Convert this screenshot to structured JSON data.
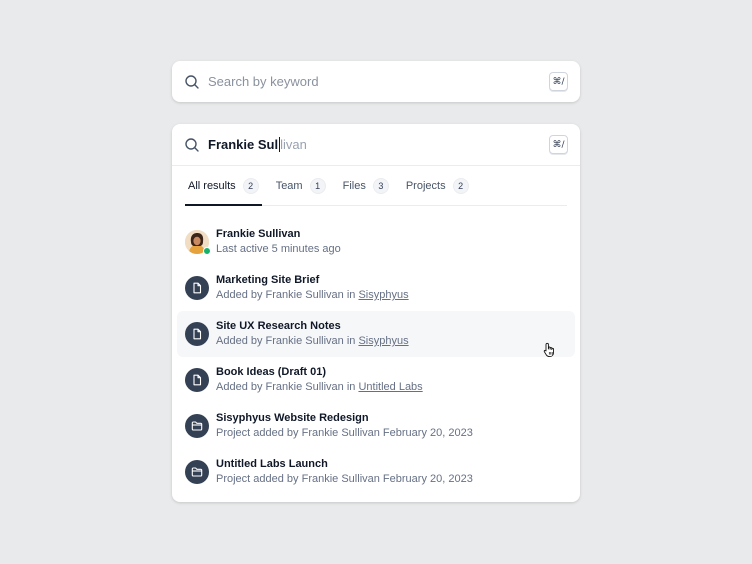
{
  "search_empty": {
    "placeholder": "Search by keyword",
    "shortcut": "⌘/"
  },
  "search_active": {
    "typed": "Frankie Sul",
    "suggestion": "livan",
    "shortcut": "⌘/"
  },
  "tabs": [
    {
      "label": "All results",
      "count": "2"
    },
    {
      "label": "Team",
      "count": "1"
    },
    {
      "label": "Files",
      "count": "3"
    },
    {
      "label": "Projects",
      "count": "2"
    }
  ],
  "results": [
    {
      "title": "Frankie Sullivan",
      "sub": "Last active 5 minutes ago",
      "icon": "avatar"
    },
    {
      "title": "Marketing Site Brief",
      "sub_prefix": "Added by Frankie Sullivan in ",
      "link": "Sisyphyus",
      "icon": "file-icon"
    },
    {
      "title": "Site UX Research Notes",
      "sub_prefix": "Added by Frankie Sullivan in ",
      "link": "Sisyphyus",
      "icon": "file-icon"
    },
    {
      "title": "Book Ideas (Draft 01)",
      "sub_prefix": "Added by Frankie Sullivan in ",
      "link": "Untitled Labs",
      "icon": "file-icon"
    },
    {
      "title": "Sisyphyus Website Redesign",
      "sub": "Project added by Frankie Sullivan February 20, 2023",
      "icon": "folder-icon"
    },
    {
      "title": "Untitled Labs Launch",
      "sub": "Project added by Frankie Sullivan February 20, 2023",
      "icon": "folder-icon"
    }
  ],
  "colors": {
    "background": "#e9eaeb",
    "icon_bg": "#344054",
    "presence": "#17b26a",
    "hover_row": "#f6f7f9"
  }
}
